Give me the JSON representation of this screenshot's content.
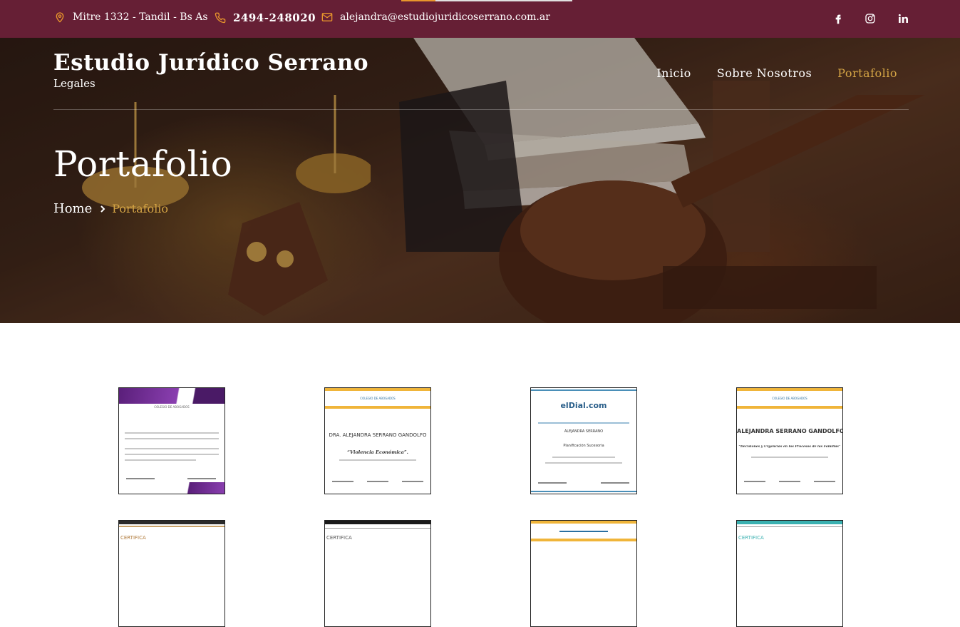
{
  "topbar": {
    "address": "Mitre 1332 - Tandil - Bs As",
    "phone": "2494-248020",
    "email": "alejandra@estudiojuridicoserrano.com.ar",
    "icons": [
      "map-pin-icon",
      "phone-icon",
      "mail-icon"
    ],
    "social": [
      "facebook-icon",
      "instagram-icon",
      "linkedin-icon"
    ]
  },
  "brand": {
    "name": "Estudio Jurídico Serrano",
    "tagline": "Legales"
  },
  "nav": {
    "items": [
      "Inicio",
      "Sobre Nosotros",
      "Portafolio"
    ],
    "active": "Portafolio"
  },
  "hero": {
    "title": "Portafolio",
    "breadcrumb": [
      "Home",
      "Portafolio"
    ]
  },
  "gallery": {
    "row1": [
      {
        "name": "DRA. ALEJANDRA SERRANO GANDOLFO",
        "subject": "“VIOLENCIA ECONÓMICA”",
        "issuer": "COLEGIO DE ABOGADOS"
      },
      {
        "name": "DRA. ALEJANDRA SERRANO GANDOLFO",
        "subject": "“Violencia Económica”.",
        "issuer": "COLEGIO DE ABOGADOS"
      },
      {
        "name": "ALEJANDRA SERRANO",
        "subject": "Planificación Sucesoria",
        "issuer": "elDial.com"
      },
      {
        "name": "ALEJANDRA SERRANO GANDOLFO",
        "subject": "“Decisiones y Urgencias en los Procesos de las Familias”",
        "issuer": "COLEGIO DE ABOGADOS"
      }
    ],
    "row2": [
      {
        "label": "CERTIFICA"
      },
      {
        "label": "CERTIFICA"
      },
      {
        "label": ""
      },
      {
        "label": "CERTIFICA"
      }
    ]
  },
  "colors": {
    "topbar": "#661f35",
    "accent": "#d4a445",
    "purple": "#6a2a8a",
    "gold_band": "#f0b53a"
  }
}
